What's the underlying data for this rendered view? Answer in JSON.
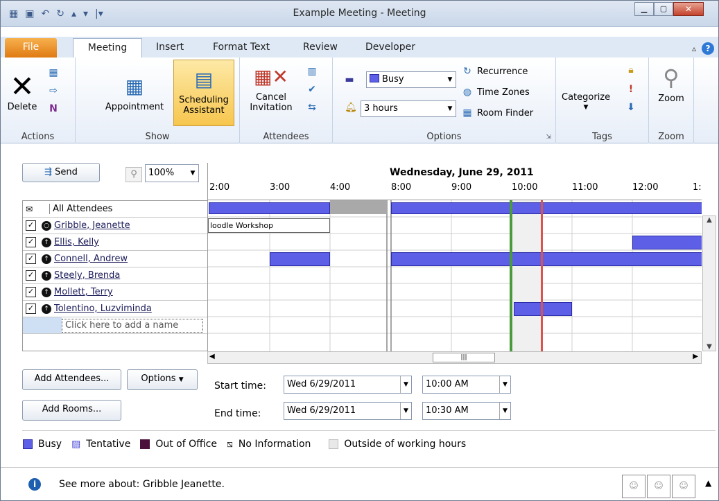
{
  "window": {
    "title": "Example Meeting - Meeting"
  },
  "tabs": [
    "File",
    "Meeting",
    "Insert",
    "Format Text",
    "Review",
    "Developer"
  ],
  "ribbon": {
    "groups": [
      "Actions",
      "Show",
      "Attendees",
      "Options",
      "Tags",
      "Zoom"
    ],
    "delete": "Delete",
    "appointment": "Appointment",
    "scheduling_line1": "Scheduling",
    "scheduling_line2": "Assistant",
    "cancel_line1": "Cancel",
    "cancel_line2": "Invitation",
    "show_as": "Busy",
    "reminder": "3 hours",
    "recurrence": "Recurrence",
    "time_zones": "Time Zones",
    "room_finder": "Room Finder",
    "categorize": "Categorize",
    "zoom": "Zoom"
  },
  "scheduler": {
    "send": "Send",
    "zoom_level": "100%",
    "date_header": "Wednesday, June 29, 2011",
    "hours": [
      "2:00",
      "3:00",
      "4:00",
      "8:00",
      "9:00",
      "10:00",
      "11:00",
      "12:00",
      "1:"
    ],
    "all_attendees": "All Attendees",
    "attendees": [
      "Gribble, Jeanette",
      "Ellis, Kelly",
      "Connell, Andrew",
      "Steely, Brenda",
      "Mollett, Terry",
      "Tolentino, Luzviminda"
    ],
    "add_name_placeholder": "Click here to add a name",
    "event_label": "loodle Workshop",
    "add_attendees": "Add Attendees...",
    "options": "Options",
    "add_rooms": "Add Rooms...",
    "start_label": "Start time:",
    "end_label": "End time:",
    "start_date": "Wed 6/29/2011",
    "start_time": "10:00 AM",
    "end_date": "Wed 6/29/2011",
    "end_time": "10:30 AM"
  },
  "legend": {
    "busy": "Busy",
    "tentative": "Tentative",
    "out_of_office": "Out of Office",
    "no_info": "No Information",
    "outside": "Outside of working hours"
  },
  "info_bar": {
    "text": "See more about: Gribble Jeanette."
  },
  "colors": {
    "busy": "#5d5fe6",
    "out_of_office": "#4b0f3b",
    "start_line": "#4a9a3c",
    "end_line": "#d9534f"
  }
}
